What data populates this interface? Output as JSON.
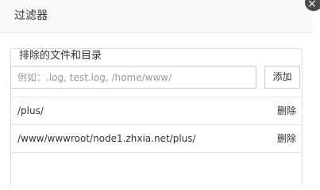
{
  "dialog": {
    "title": "过滤器",
    "close_label": "×"
  },
  "exclude_group": {
    "legend": "排除的文件和目录",
    "input": {
      "value": "",
      "placeholder": "例如：.log, test.log, /home/www/"
    },
    "add_label": "添加"
  },
  "excluded_list": [
    {
      "path": "/plus/",
      "delete_label": "删除"
    },
    {
      "path": "/www/wwwroot/node1.zhxia.net/plus/",
      "delete_label": "删除"
    }
  ]
}
